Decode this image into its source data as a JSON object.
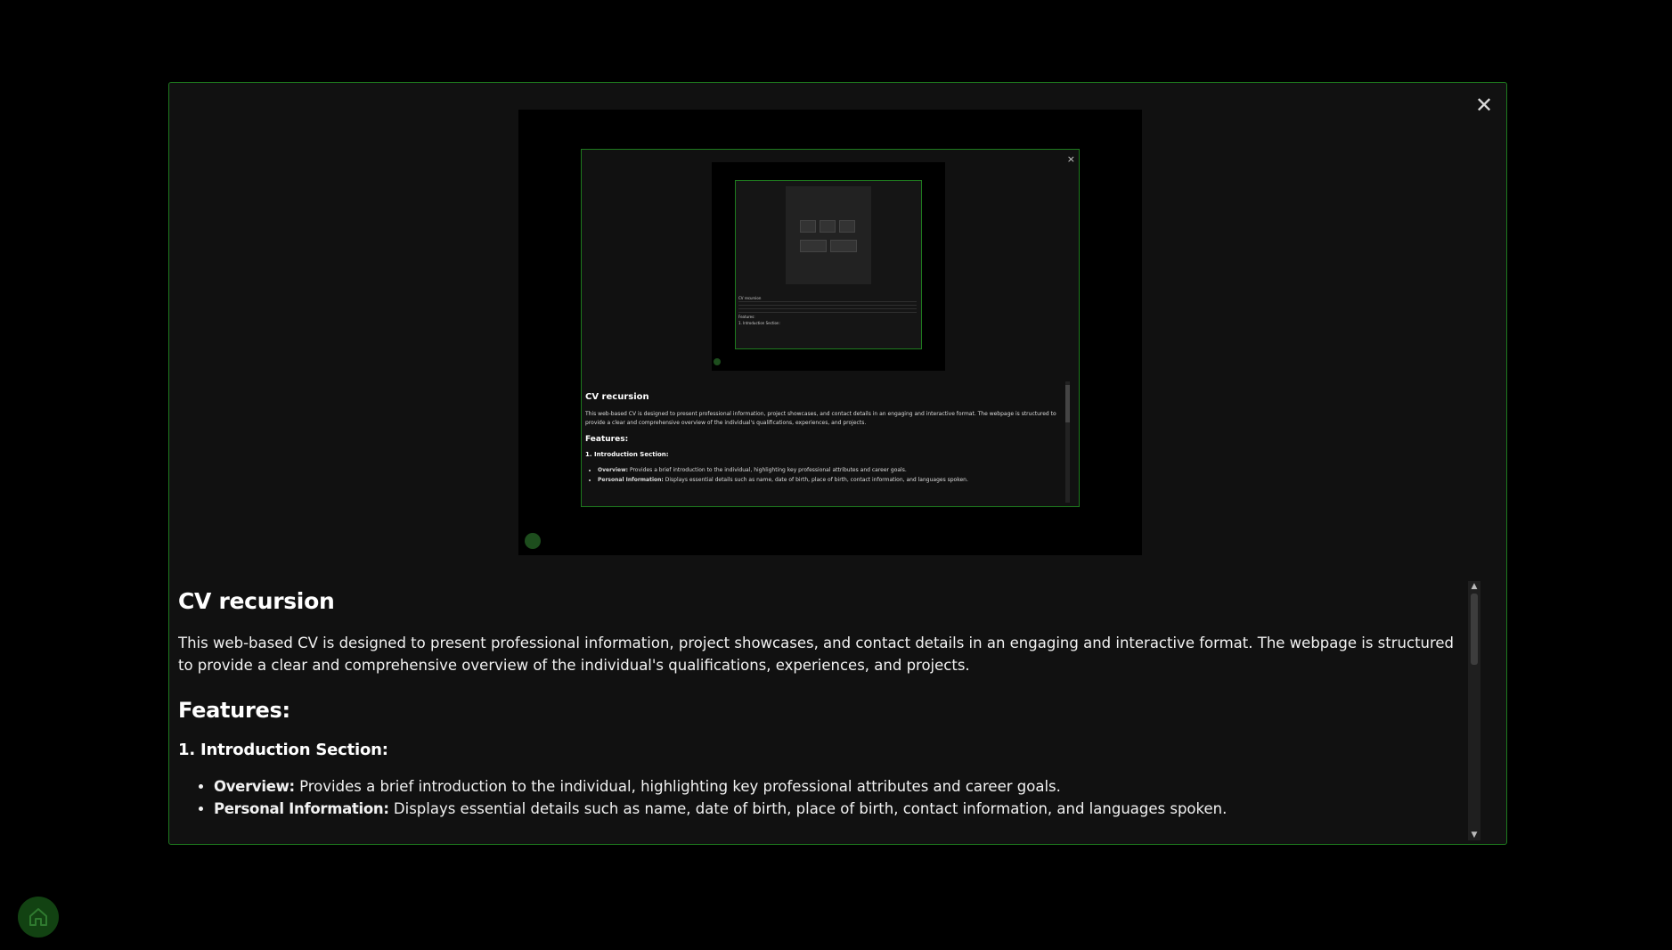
{
  "modal": {
    "close_label": "✕",
    "preview": {
      "inner_close_label": "×",
      "inner_title": "CV recursion",
      "inner_para": "This web-based CV is designed to present professional information, project showcases, and contact details in an engaging and interactive format. The webpage is structured to provide a clear and comprehensive overview of the individual's qualifications, experiences, and projects.",
      "inner_features": "Features:",
      "inner_section": "1. Introduction Section:",
      "inner_items": [
        {
          "label": "Overview:",
          "text": " Provides a brief introduction to the individual, highlighting key professional attributes and career goals."
        },
        {
          "label": "Personal Information:",
          "text": " Displays essential details such as name, date of birth, place of birth, contact information, and languages spoken."
        }
      ],
      "l2_title": "CV recursion",
      "l2_features": "Features:",
      "l2_section": "1. Introduction Section:",
      "l2_chips": [
        " ",
        " ",
        " ",
        " ",
        " "
      ]
    },
    "content": {
      "title": "CV recursion",
      "description": "This web-based CV is designed to present professional information, project showcases, and contact details in an engaging and interactive format. The webpage is structured to provide a clear and comprehensive overview of the individual's qualifications, experiences, and projects.",
      "features_heading": "Features:",
      "section_heading": "1. Introduction Section:",
      "items": [
        {
          "label": "Overview:",
          "text": " Provides a brief introduction to the individual, highlighting key professional attributes and career goals."
        },
        {
          "label": "Personal Information:",
          "text": " Displays essential details such as name, date of birth, place of birth, contact information, and languages spoken."
        }
      ]
    },
    "scrollbar": {
      "up": "▲",
      "down": "▼"
    }
  },
  "home": {
    "icon": "home-icon"
  },
  "colors": {
    "accent": "#1e7a1e",
    "background": "#000000",
    "panel": "#111111",
    "home_button": "#124212"
  }
}
